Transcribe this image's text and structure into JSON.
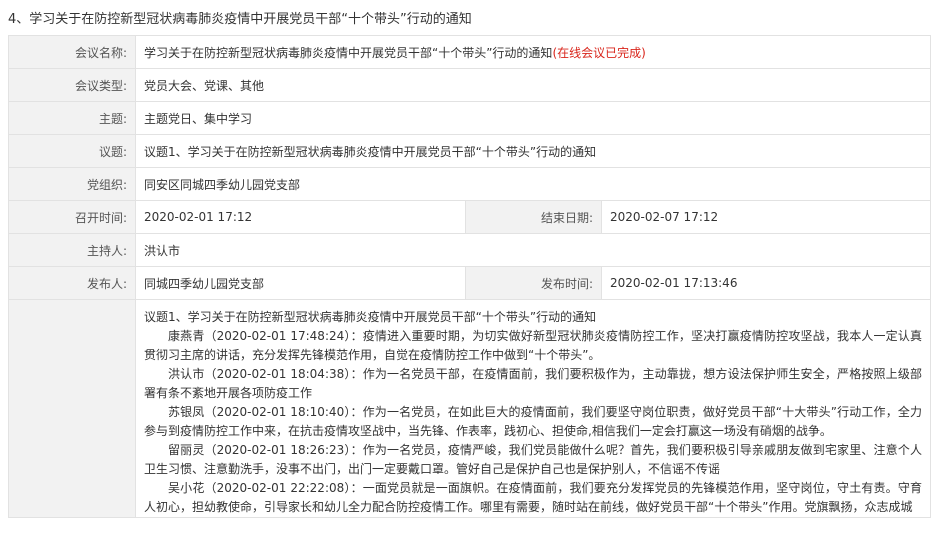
{
  "page": {
    "title": "4、学习关于在防控新型冠状病毒肺炎疫情中开展党员干部“十个带头”行动的通知"
  },
  "meeting": {
    "name_label": "会议名称:",
    "name_value": "学习关于在防控新型冠状病毒肺炎疫情中开展党员干部“十个带头”行动的通知",
    "status": "(在线会议已完成)",
    "type_label": "会议类型:",
    "type_value": "党员大会、党课、其他",
    "theme_label": "主题:",
    "theme_value": "主题党日、集中学习",
    "agenda_label": "议题:",
    "agenda_value": "议题1、学习关于在防控新型冠状病毒肺炎疫情中开展党员干部“十个带头”行动的通知",
    "org_label": "党组织:",
    "org_value": "同安区同城四季幼儿园党支部",
    "start_label": "召开时间:",
    "start_value": "2020-02-01 17:12",
    "end_label": "结束日期:",
    "end_value": "2020-02-07 17:12",
    "host_label": "主持人:",
    "host_value": "洪认市",
    "publisher_label": "发布人:",
    "publisher_value": "同城四季幼儿园党支部",
    "publish_time_label": "发布时间:",
    "publish_time_value": "2020-02-01 17:13:46"
  },
  "discussion": {
    "topic": "议题1、学习关于在防控新型冠状病毒肺炎疫情中开展党员干部“十个带头”行动的通知",
    "entries": [
      "康燕青（2020-02-01 17:48:24）：疫情进入重要时期，为切实做好新型冠状肺炎疫情防控工作，坚决打赢疫情防控攻坚战，我本人一定认真贯彻习主席的讲话，充分发挥先锋模范作用，自觉在疫情防控工作中做到“十个带头”。",
      "洪认市（2020-02-01 18:04:38）：作为一名党员干部，在疫情面前，我们要积极作为，主动靠拢，想方设法保护师生安全，严格按照上级部署有条不紊地开展各项防疫工作",
      "苏银凤（2020-02-01 18:10:40）：作为一名党员，在如此巨大的疫情面前，我们要坚守岗位职责，做好党员干部“十大带头”行动工作，全力参与到疫情防控工作中来，在抗击疫情攻坚战中，当先锋、作表率，践初心、担使命,相信我们一定会打赢这一场没有硝烟的战争。",
      "留丽灵（2020-02-01 18:26:23）：作为一名党员，疫情严峻，我们党员能做什么呢？首先，我们要积极引导亲戚朋友做到宅家里、注意个人卫生习惯、注意勤洗手，没事不出门，出门一定要戴口罩。管好自己是保护自己也是保护别人，不信谣不传谣",
      "吴小花（2020-02-01 22:22:08）：一面党员就是一面旗帜。在疫情面前，我们要充分发挥党员的先锋模范作用，坚守岗位，守土有责。守育人初心，担幼教使命，引导家长和幼儿全力配合防控疫情工作。哪里有需要，随时站在前线，做好党员干部“十个带头”作用。党旗飘扬，众志成城"
    ]
  }
}
